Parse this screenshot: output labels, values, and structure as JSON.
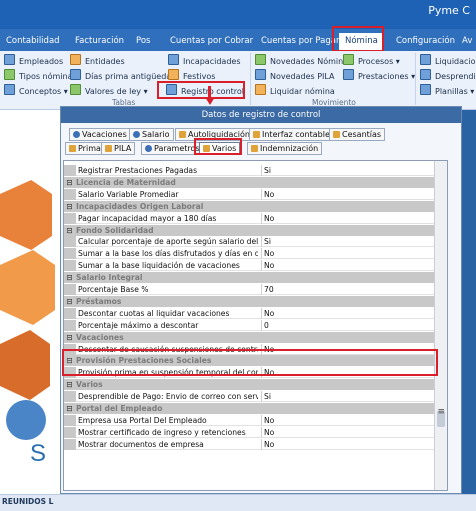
{
  "window": {
    "title": "Pyme C"
  },
  "tabs": [
    {
      "label": "Contabilidad"
    },
    {
      "label": "Facturación"
    },
    {
      "label": "Pos"
    },
    {
      "label": "Cuentas por Cobrar"
    },
    {
      "label": "Cuentas por Pagar"
    },
    {
      "label": "Nómina"
    },
    {
      "label": "Configuración"
    },
    {
      "label": "Av"
    }
  ],
  "ribbon": {
    "items": [
      {
        "label": "Empleados"
      },
      {
        "label": "Tipos nómina"
      },
      {
        "label": "Conceptos"
      },
      {
        "label": "Entidades"
      },
      {
        "label": "Días prima antigüedad"
      },
      {
        "label": "Valores de ley"
      },
      {
        "label": "Incapacidades"
      },
      {
        "label": "Festivos"
      },
      {
        "label": "Registro control"
      },
      {
        "label": "Novedades Nómina"
      },
      {
        "label": "Novedades PILA"
      },
      {
        "label": "Liquidar nómina"
      },
      {
        "label": "Procesos"
      },
      {
        "label": "Prestaciones"
      },
      {
        "label": "Liquidacion"
      },
      {
        "label": "Desprendib"
      },
      {
        "label": "Planillas"
      }
    ],
    "groups": [
      {
        "label": "Tablas"
      },
      {
        "label": "Movimiento"
      }
    ]
  },
  "dialog": {
    "title": "Datos de registro de control",
    "tabs_row1": [
      {
        "label": "Vacaciones"
      },
      {
        "label": "Salario"
      },
      {
        "label": "Autoliquidación"
      },
      {
        "label": "Interfaz contable"
      },
      {
        "label": "Cesantías"
      }
    ],
    "tabs_row2": [
      {
        "label": "Prima"
      },
      {
        "label": "PILA"
      },
      {
        "label": "Parametros"
      },
      {
        "label": "Varios"
      },
      {
        "label": "Indemnización"
      }
    ]
  },
  "grid": {
    "rows": [
      {
        "kind": "prop",
        "name": "Registrar Prestaciones Pagadas",
        "value": "Si"
      },
      {
        "kind": "cat",
        "name": "Licencia de Maternidad"
      },
      {
        "kind": "prop",
        "name": "Salario Variable Promediar",
        "value": "No"
      },
      {
        "kind": "cat",
        "name": "Incapacidades Origen Laboral"
      },
      {
        "kind": "prop",
        "name": "Pagar incapacidad mayor a 180 días",
        "value": "No"
      },
      {
        "kind": "cat",
        "name": "Fondo Solidaridad"
      },
      {
        "kind": "prop",
        "name": "Calcular porcentaje de aporte según salario del emplea",
        "value": "Si"
      },
      {
        "kind": "prop",
        "name": "Sumar a la base los días disfrutados y días en dinero d",
        "value": "No"
      },
      {
        "kind": "prop",
        "name": "Sumar a la base liquidación de vacaciones",
        "value": "No"
      },
      {
        "kind": "cat",
        "name": "Salario Integral"
      },
      {
        "kind": "prop",
        "name": "Porcentaje Base %",
        "value": "70"
      },
      {
        "kind": "cat",
        "name": "Préstamos"
      },
      {
        "kind": "prop",
        "name": "Descontar cuotas al liquidar vacaciones",
        "value": "No"
      },
      {
        "kind": "prop",
        "name": "Porcentaje máximo a descontar",
        "value": "0"
      },
      {
        "kind": "cat",
        "name": "Vacaciones"
      },
      {
        "kind": "prop",
        "name": "Descontar de causación suspensiones de contrato",
        "value": "No"
      },
      {
        "kind": "cat",
        "name": "Provisión Prestaciones Sociales"
      },
      {
        "kind": "prop",
        "name": "Provisión prima en suspensión temporal del contrato",
        "value": "No"
      },
      {
        "kind": "cat",
        "name": "Varios"
      },
      {
        "kind": "prop",
        "name": "Desprendible de Pago: Envio de correo con servidor C",
        "value": "Si"
      },
      {
        "kind": "cat",
        "name": "Portal del Empleado"
      },
      {
        "kind": "prop",
        "name": "Empresa usa Portal Del Empleado",
        "value": "No"
      },
      {
        "kind": "prop",
        "name": "Mostrar certificado de ingreso y retenciones",
        "value": "No"
      },
      {
        "kind": "prop",
        "name": "Mostrar documentos de empresa",
        "value": "No"
      }
    ]
  },
  "left": {
    "letter": "S"
  },
  "statusbar": {
    "text": "REUNIDOS L"
  },
  "colors": {
    "highlight": "#d91f2a",
    "accent": "#1e62b5",
    "category_bg": "#c8c8c8"
  }
}
